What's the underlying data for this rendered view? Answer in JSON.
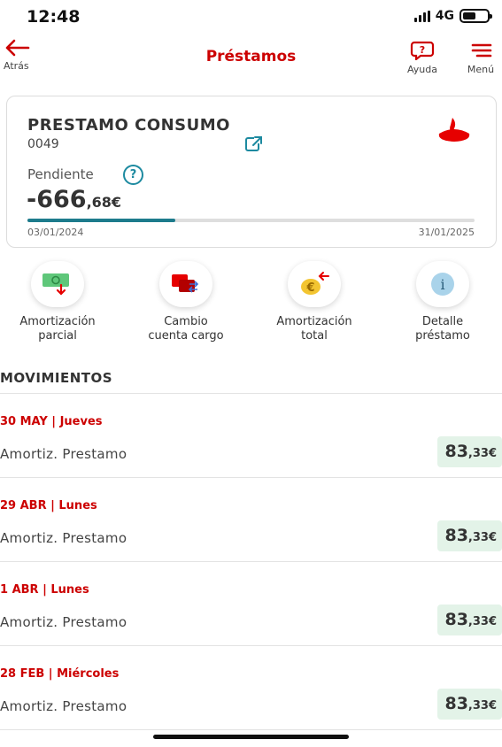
{
  "status_bar": {
    "time": "12:48",
    "network": "4G",
    "battery_level": 0.55
  },
  "header": {
    "back_label": "Atrás",
    "title": "Préstamos",
    "help_label": "Ayuda",
    "menu_label": "Menú"
  },
  "loan": {
    "name": "PRESTAMO CONSUMO",
    "number": "0049",
    "pending_label": "Pendiente",
    "amount_main": "-666",
    "amount_cents": ",68€",
    "progress": 0.33,
    "start_date": "03/01/2024",
    "end_date": "31/01/2025"
  },
  "actions": [
    {
      "icon": "money-down-icon",
      "line1": "Amortización",
      "line2": "parcial"
    },
    {
      "icon": "cards-exchange-icon",
      "line1": "Cambio",
      "line2": "cuenta cargo"
    },
    {
      "icon": "euro-coin-icon",
      "line1": "Amortización",
      "line2": "total"
    },
    {
      "icon": "info-icon",
      "line1": "Detalle",
      "line2": "préstamo"
    }
  ],
  "movements_title": "MOVIMIENTOS",
  "movements": [
    {
      "date": "30 MAY | Jueves",
      "description": "Amortiz. Prestamo",
      "amount_main": "83",
      "amount_cents": ",33€"
    },
    {
      "date": "29 ABR | Lunes",
      "description": "Amortiz. Prestamo",
      "amount_main": "83",
      "amount_cents": ",33€"
    },
    {
      "date": "1 ABR | Lunes",
      "description": "Amortiz. Prestamo",
      "amount_main": "83",
      "amount_cents": ",33€"
    },
    {
      "date": "28 FEB | Miércoles",
      "description": "Amortiz. Prestamo",
      "amount_main": "83",
      "amount_cents": ",33€"
    }
  ],
  "colors": {
    "brand": "#cc0000",
    "accent": "#1d7b8c",
    "amount_bg": "#e3f3e8"
  }
}
